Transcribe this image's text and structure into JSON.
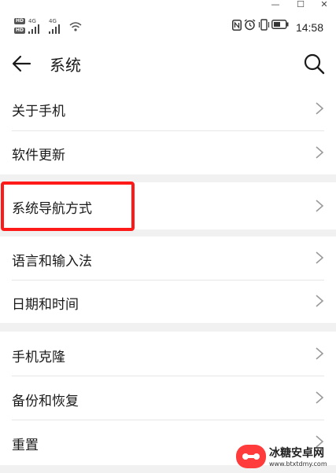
{
  "window_controls": {
    "minimize": "—",
    "maximize": "☐",
    "close": "✕"
  },
  "status_bar": {
    "sim1_tag": "HD",
    "sim2_tag": "HD",
    "sim1_network": "4G",
    "sim2_network": "4G",
    "time": "14:58",
    "icons": [
      "nfc-icon",
      "alarm-icon",
      "vibrate-icon",
      "battery-icon"
    ]
  },
  "header": {
    "title": "系统",
    "back_icon": "arrow-left-icon",
    "search_icon": "search-icon"
  },
  "groups": [
    {
      "items": [
        {
          "label": "关于手机"
        },
        {
          "label": "软件更新"
        }
      ]
    },
    {
      "items": [
        {
          "label": "系统导航方式",
          "highlighted": true
        }
      ]
    },
    {
      "items": [
        {
          "label": "语言和输入法"
        },
        {
          "label": "日期和时间"
        }
      ]
    },
    {
      "items": [
        {
          "label": "手机克隆"
        },
        {
          "label": "备份和恢复"
        },
        {
          "label": "重置"
        }
      ]
    }
  ],
  "watermark": {
    "name": "冰糖安卓网",
    "url": "www.btxtdmy.com"
  },
  "colors": {
    "accent_highlight": "#ff1a1a",
    "background": "#f1f1f1",
    "card": "#ffffff"
  }
}
